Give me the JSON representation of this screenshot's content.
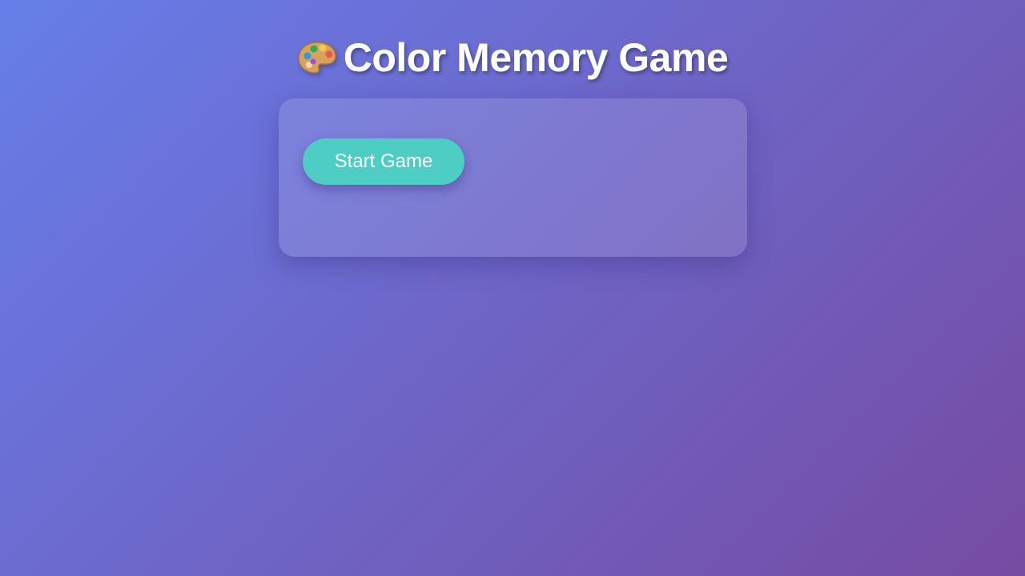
{
  "header": {
    "icon": "palette-icon",
    "title": "Color Memory Game"
  },
  "game": {
    "start_label": "Start Game"
  },
  "colors": {
    "background_start": "#667eea",
    "background_end": "#764ba2",
    "button": "#4ecdc4",
    "text": "#ffffff"
  }
}
